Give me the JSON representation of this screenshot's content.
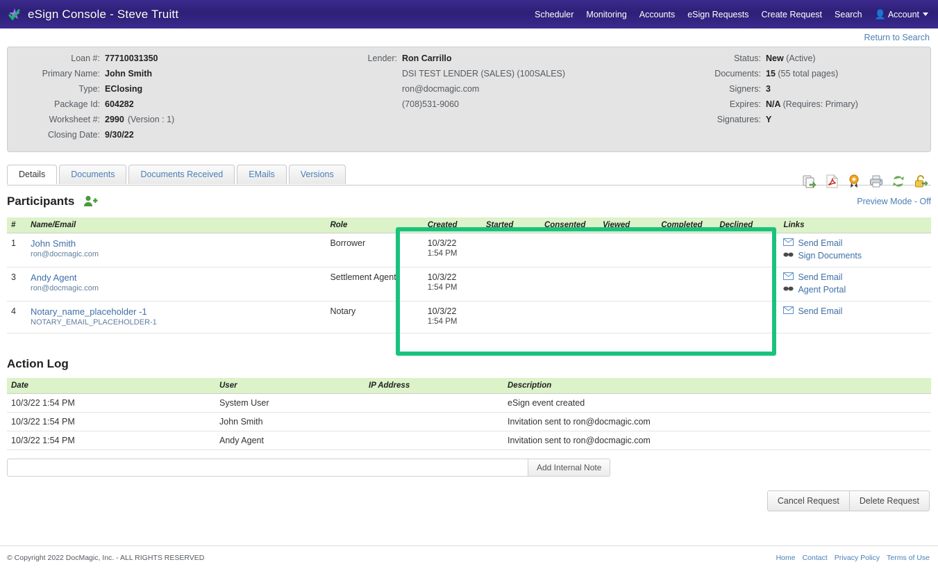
{
  "header": {
    "title": "eSign Console - Steve Truitt",
    "logo_icon": "checkmark-star-icon",
    "nav": [
      {
        "label": "Scheduler",
        "name": "nav-scheduler"
      },
      {
        "label": "Monitoring",
        "name": "nav-monitoring"
      },
      {
        "label": "Accounts",
        "name": "nav-accounts"
      },
      {
        "label": "eSign Requests",
        "name": "nav-esign-requests"
      },
      {
        "label": "Create Request",
        "name": "nav-create-request"
      },
      {
        "label": "Search",
        "name": "nav-search"
      }
    ],
    "account_label": "Account",
    "account_icon": "person-icon",
    "return_link": "Return to Search"
  },
  "summary": {
    "left": [
      {
        "label": "Loan #:",
        "value": "77710031350",
        "sub": ""
      },
      {
        "label": "Primary Name:",
        "value": "John Smith",
        "sub": ""
      },
      {
        "label": "Type:",
        "value": "EClosing",
        "sub": ""
      },
      {
        "label": "Package Id:",
        "value": "604282",
        "sub": ""
      },
      {
        "label": "Worksheet #:",
        "value": "2990",
        "sub": "(Version : 1)"
      },
      {
        "label": "Closing Date:",
        "value": "9/30/22",
        "sub": ""
      }
    ],
    "lender": {
      "label": "Lender:",
      "name": "Ron Carrillo",
      "company": "DSI TEST LENDER (SALES) (100SALES)",
      "email": "ron@docmagic.com",
      "phone": "(708)531-9060"
    },
    "right": [
      {
        "label": "Status:",
        "value": "New",
        "sub": "(Active)"
      },
      {
        "label": "Documents:",
        "value": "15",
        "sub": "(55 total pages)"
      },
      {
        "label": "Signers:",
        "value": "3",
        "sub": ""
      },
      {
        "label": "Expires:",
        "value": "N/A",
        "sub": "(Requires: Primary)"
      },
      {
        "label": "Signatures:",
        "value": "Y",
        "sub": ""
      }
    ]
  },
  "tabs": [
    {
      "label": "Details",
      "active": true
    },
    {
      "label": "Documents",
      "active": false
    },
    {
      "label": "Documents Received",
      "active": false
    },
    {
      "label": "EMails",
      "active": false
    },
    {
      "label": "Versions",
      "active": false
    }
  ],
  "toolbar_icons": [
    {
      "name": "copy-documents-icon",
      "title": "Copy"
    },
    {
      "name": "pdf-icon",
      "title": "PDF"
    },
    {
      "name": "notary-seal-icon",
      "title": "Notary Seal"
    },
    {
      "name": "print-icon",
      "title": "Print"
    },
    {
      "name": "refresh-icon",
      "title": "Refresh"
    },
    {
      "name": "unlock-icon",
      "title": "Lock"
    }
  ],
  "participants": {
    "title": "Participants",
    "add_icon": "add-person-icon",
    "preview_mode": "Preview Mode - Off",
    "columns": [
      "#",
      "Name/Email",
      "Role",
      "Created",
      "Started",
      "Consented",
      "Viewed",
      "Completed",
      "Declined",
      "Links"
    ],
    "rows": [
      {
        "num": "1",
        "name": "John Smith",
        "email": "ron@docmagic.com",
        "role": "Borrower",
        "created_date": "10/3/22",
        "created_time": "1:54 PM",
        "started": "",
        "consented": "",
        "viewed": "",
        "completed": "",
        "declined": "",
        "links": [
          {
            "label": "Send Email",
            "icon": "envelope-icon"
          },
          {
            "label": "Sign Documents",
            "icon": "glasses-icon"
          }
        ]
      },
      {
        "num": "3",
        "name": "Andy Agent",
        "email": "ron@docmagic.com",
        "role": "Settlement Agent",
        "created_date": "10/3/22",
        "created_time": "1:54 PM",
        "started": "",
        "consented": "",
        "viewed": "",
        "completed": "",
        "declined": "",
        "links": [
          {
            "label": "Send Email",
            "icon": "envelope-icon"
          },
          {
            "label": "Agent Portal",
            "icon": "glasses-icon"
          }
        ]
      },
      {
        "num": "4",
        "name": "Notary_name_placeholder -1",
        "email": "NOTARY_EMAIL_PLACEHOLDER-1",
        "role": "Notary",
        "created_date": "10/3/22",
        "created_time": "1:54 PM",
        "started": "",
        "consented": "",
        "viewed": "",
        "completed": "",
        "declined": "",
        "links": [
          {
            "label": "Send Email",
            "icon": "envelope-icon"
          }
        ]
      }
    ]
  },
  "action_log": {
    "title": "Action Log",
    "columns": [
      "Date",
      "User",
      "IP Address",
      "Description"
    ],
    "rows": [
      {
        "date": "10/3/22 1:54 PM",
        "user": "System User",
        "ip": "",
        "description": "eSign event created"
      },
      {
        "date": "10/3/22 1:54 PM",
        "user": "John Smith",
        "ip": "",
        "description": "Invitation sent to ron@docmagic.com"
      },
      {
        "date": "10/3/22 1:54 PM",
        "user": "Andy Agent",
        "ip": "",
        "description": "Invitation sent to ron@docmagic.com"
      }
    ]
  },
  "note": {
    "value": "",
    "placeholder": "",
    "button_label": "Add Internal Note"
  },
  "actions": {
    "cancel_label": "Cancel Request",
    "delete_label": "Delete Request"
  },
  "footer": {
    "copyright": "© Copyright 2022 DocMagic, Inc. - ALL RIGHTS RESERVED",
    "links": [
      "Home",
      "Contact",
      "Privacy Policy",
      "Terms of Use"
    ]
  },
  "colors": {
    "nav_bg": "#2e1f78",
    "link": "#4a7fb5",
    "table_header": "#dcf2c8",
    "highlight": "#19c37d",
    "panel_bg": "#e4e4e4"
  }
}
